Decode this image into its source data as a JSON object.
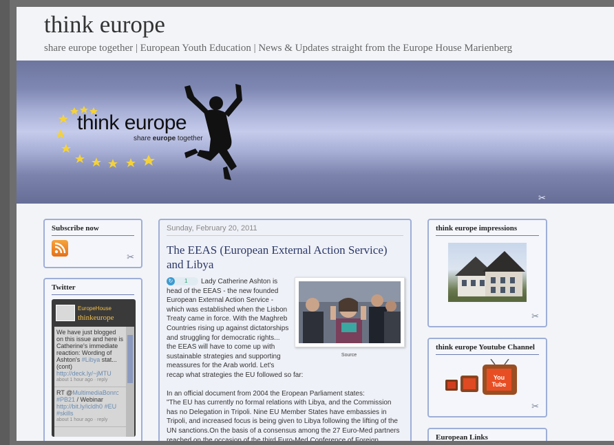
{
  "blog": {
    "title": "think europe",
    "description": "share europe together | European Youth Education | News & Updates straight from the Europe House Marienberg"
  },
  "banner": {
    "logo_text": "think europe",
    "logo_sub_prefix": "share ",
    "logo_sub_bold": "europe",
    "logo_sub_suffix": " together"
  },
  "sidebar_left": {
    "subscribe_title": "Subscribe now",
    "rss_glyph": ")",
    "twitter_title": "Twitter",
    "twitter_name": "EuropeHouse",
    "twitter_handle": "thinkeurope",
    "tweets": [
      {
        "text": "We have just blogged on this issue and here is Catherine's immediate reaction: Wording of Ashton's ",
        "hash": "#Libya",
        "text2": " stat... (cont) ",
        "link": "http://deck.ly/~jMTU",
        "meta": "about 1 hour ago · reply"
      },
      {
        "text": "RT @",
        "mention": "MultimediaBonn",
        "text2": ": ",
        "hash": "#PB21",
        "text3": " / Webinar ",
        "link": "http://bit.ly/icldh0",
        "hash2": "#EU #skills",
        "meta": "about 1 hour ago · reply"
      }
    ]
  },
  "post": {
    "date": "Sunday, February 20, 2011",
    "title": "The EEAS (European External Action Service) and Libya",
    "badge_count": "1",
    "image_caption": "Source",
    "paragraph1": "Lady Catherine Ashton is head of the EEAS - the new founded European External Action Service - which was established when the Lisbon Treaty came in force. With the Maghreb Countries rising up against dictatorships and struggling for democratic rights... the EEAS will have to come up with sustainable strategies and supporting meassures for the Arab world. Let's recap what strategies the EU followed so far:",
    "paragraph2": "In an official document from 2004 the Eropean Parliament states:",
    "paragraph3": "\"The EU has currently no formal relations with Libya, and the Commission has no Delegation in Tripoli. Nine EU Member States have embassies in Tripoli, and increased focus is being given to Libya following the lifting of the UN sanctions.On the basis of a consensus among the 27 Euro-Med partners reached on the occasion of the third Euro-Med Conference of Foreign Ministers"
  },
  "sidebar_right": {
    "impressions_title": "think europe impressions",
    "youtube_title": "think europe Youtube Channel",
    "youtube_logo": "You Tube",
    "links_title": "European Links"
  },
  "colors": {
    "accent": "#2a3866",
    "widget_border": "#9eaed6",
    "twitter_gold": "#f4c04a"
  }
}
